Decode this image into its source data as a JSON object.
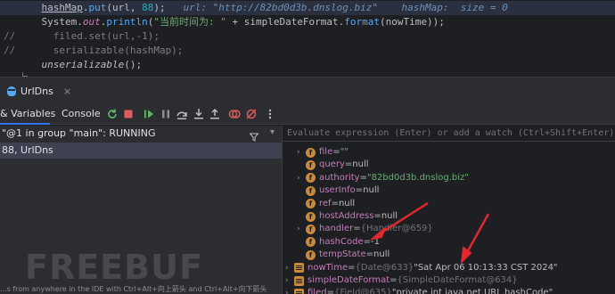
{
  "editor": {
    "lines": [
      {
        "gutter": "",
        "highlighted": true,
        "tokens": [
          {
            "t": "    ",
            "c": "k-def"
          },
          {
            "t": "hashMap",
            "c": "k-def k-under"
          },
          {
            "t": ".",
            "c": "k-def"
          },
          {
            "t": "put",
            "c": "k-method"
          },
          {
            "t": "(url, ",
            "c": "k-def"
          },
          {
            "t": "88",
            "c": "k-num"
          },
          {
            "t": ");   ",
            "c": "k-def"
          },
          {
            "t": "url: \"http://82bd0d3b.dnslog.biz\"    hashMap:  size = 0",
            "c": "k-inlay"
          }
        ]
      },
      {
        "gutter": "",
        "highlighted": false,
        "tokens": [
          {
            "t": "    System.",
            "c": "k-def"
          },
          {
            "t": "out",
            "c": "k-field"
          },
          {
            "t": ".",
            "c": "k-def"
          },
          {
            "t": "println",
            "c": "k-method"
          },
          {
            "t": "(",
            "c": "k-def"
          },
          {
            "t": "\"当前时间为: \"",
            "c": "k-str"
          },
          {
            "t": " + simpleDateFormat.",
            "c": "k-def"
          },
          {
            "t": "format",
            "c": "k-method"
          },
          {
            "t": "(nowTime));",
            "c": "k-def"
          }
        ]
      },
      {
        "gutter": "//",
        "highlighted": false,
        "tokens": [
          {
            "t": "      filed.set(url,-1);",
            "c": "k-comment"
          }
        ]
      },
      {
        "gutter": "//",
        "highlighted": false,
        "tokens": [
          {
            "t": "      serializable(hashMap);",
            "c": "k-comment"
          }
        ]
      },
      {
        "gutter": "",
        "highlighted": false,
        "tokens": [
          {
            "t": "    ",
            "c": "k-def"
          },
          {
            "t": "unserializable",
            "c": "k-def k-ital"
          },
          {
            "t": "();",
            "c": "k-def"
          }
        ]
      }
    ]
  },
  "toolwindow": {
    "tab_label": "UrlDns",
    "close_glyph": "×"
  },
  "toolbar": {
    "variables_tab": "& Variables",
    "console_tab": "Console"
  },
  "threads": {
    "current_thread": "\"@1 in group \"main\": RUNNING",
    "frame": "88, UrlDns"
  },
  "variables": {
    "eval_placeholder": "Evaluate expression (Enter) or add a watch (Ctrl+Shift+Enter)",
    "rows": [
      {
        "indent": 1,
        "expand": true,
        "icon": "field",
        "name": "file",
        "eq": " = ",
        "ref": "",
        "value": "\"\"",
        "vclass": "vstr"
      },
      {
        "indent": 1,
        "expand": false,
        "icon": "field",
        "name": "query",
        "eq": " = ",
        "ref": "",
        "value": "null",
        "vclass": "vplain"
      },
      {
        "indent": 1,
        "expand": true,
        "icon": "field",
        "name": "authority",
        "eq": " = ",
        "ref": "",
        "value": "\"82bd0d3b.dnslog.biz\"",
        "vclass": "vstr"
      },
      {
        "indent": 1,
        "expand": false,
        "icon": "field",
        "name": "userInfo",
        "eq": " = ",
        "ref": "",
        "value": "null",
        "vclass": "vplain"
      },
      {
        "indent": 1,
        "expand": false,
        "icon": "field",
        "name": "ref",
        "eq": " = ",
        "ref": "",
        "value": "null",
        "vclass": "vplain"
      },
      {
        "indent": 1,
        "expand": false,
        "icon": "field",
        "name": "hostAddress",
        "eq": " = ",
        "ref": "",
        "value": "null",
        "vclass": "vplain"
      },
      {
        "indent": 1,
        "expand": true,
        "icon": "field",
        "name": "handler",
        "eq": " = ",
        "ref": "{Handler@659}",
        "value": "",
        "vclass": "vplain"
      },
      {
        "indent": 1,
        "expand": false,
        "icon": "field",
        "name": "hashCode",
        "eq": " = ",
        "ref": "",
        "value": "-1",
        "vclass": "vplain"
      },
      {
        "indent": 1,
        "expand": false,
        "icon": "field",
        "name": "tempState",
        "eq": " = ",
        "ref": "",
        "value": "null",
        "vclass": "vplain"
      },
      {
        "indent": 0,
        "expand": true,
        "icon": "var",
        "name": "nowTime",
        "eq": " = ",
        "ref": "{Date@633}",
        "value": " \"Sat Apr 06 10:13:33 CST 2024\"",
        "vclass": "vplain"
      },
      {
        "indent": 0,
        "expand": true,
        "icon": "var",
        "name": "simpleDateFormat",
        "eq": " = ",
        "ref": "{SimpleDateFormat@634}",
        "value": "",
        "vclass": "vplain"
      },
      {
        "indent": 0,
        "expand": true,
        "icon": "var",
        "name": "filed",
        "eq": " = ",
        "ref": "{Field@635}",
        "value": " \"private int java.net.URL.hashCode\"",
        "vclass": "vplain"
      }
    ]
  },
  "status": {
    "text": "...s from anywhere in the IDE with Ctrl+Alt+向上箭头 and Ctrl+Alt+向下箭头"
  },
  "watermark": {
    "text": "FREEBUF"
  },
  "colors": {
    "accent": "#3574f0",
    "arrow": "#e0282e",
    "field_icon": "#c98a3c"
  }
}
